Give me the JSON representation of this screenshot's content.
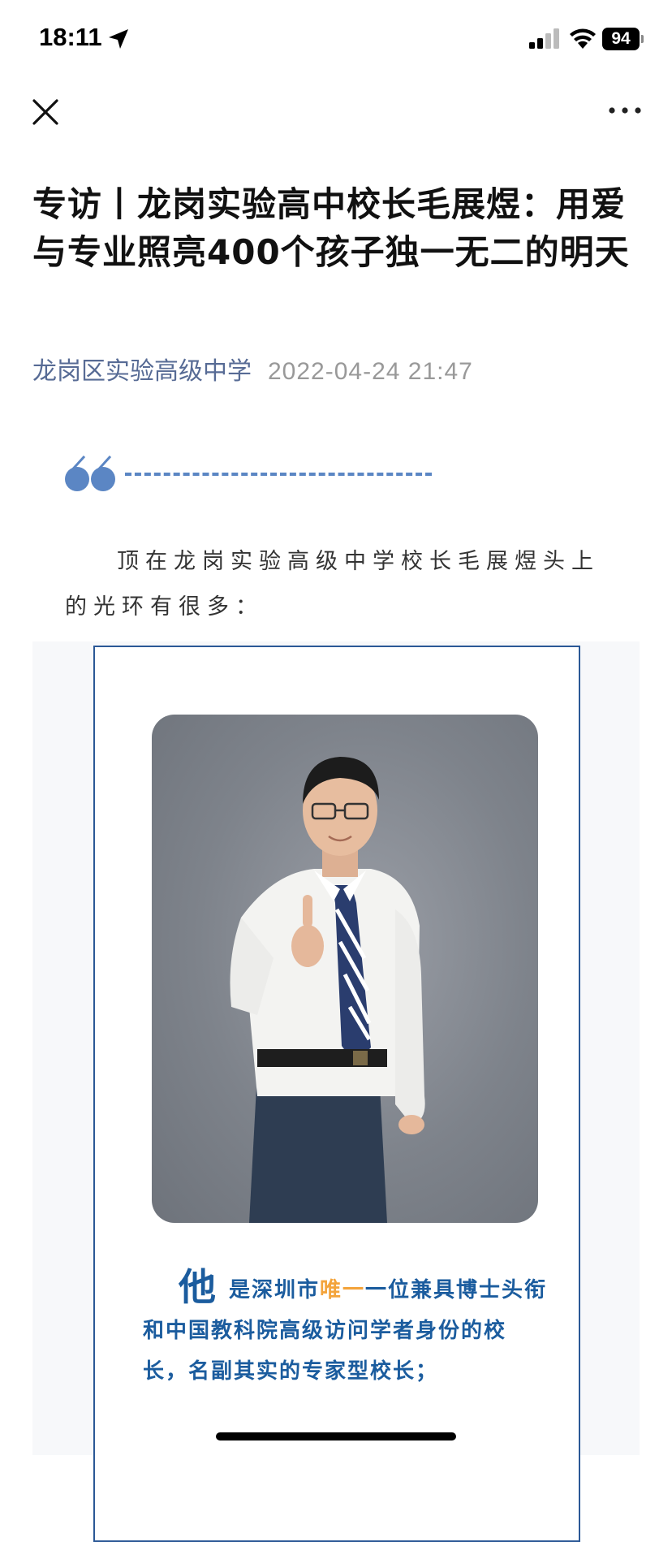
{
  "status": {
    "time": "18:11",
    "battery": "94"
  },
  "article": {
    "title": "专访丨龙岗实验高中校长毛展煜：用爱与专业照亮400个孩子独一无二的明天",
    "author": "龙岗区实验高级中学",
    "date": "2022-04-24 21:47",
    "intro": "顶在龙岗实验高级中学校长毛展煜头上的光环有很多："
  },
  "card": {
    "big_char": "他",
    "desc_before": "是深圳市",
    "desc_highlight": "唯一",
    "desc_after": "一位兼具博士头衔和中国教科院高级访问学者身份的校长，名副其实的专家型校长；"
  },
  "colors": {
    "accent": "#576b95",
    "card_border": "#2b5896",
    "card_text": "#1b5c9e",
    "highlight": "#f3a43c",
    "quote": "#5b86c4"
  }
}
